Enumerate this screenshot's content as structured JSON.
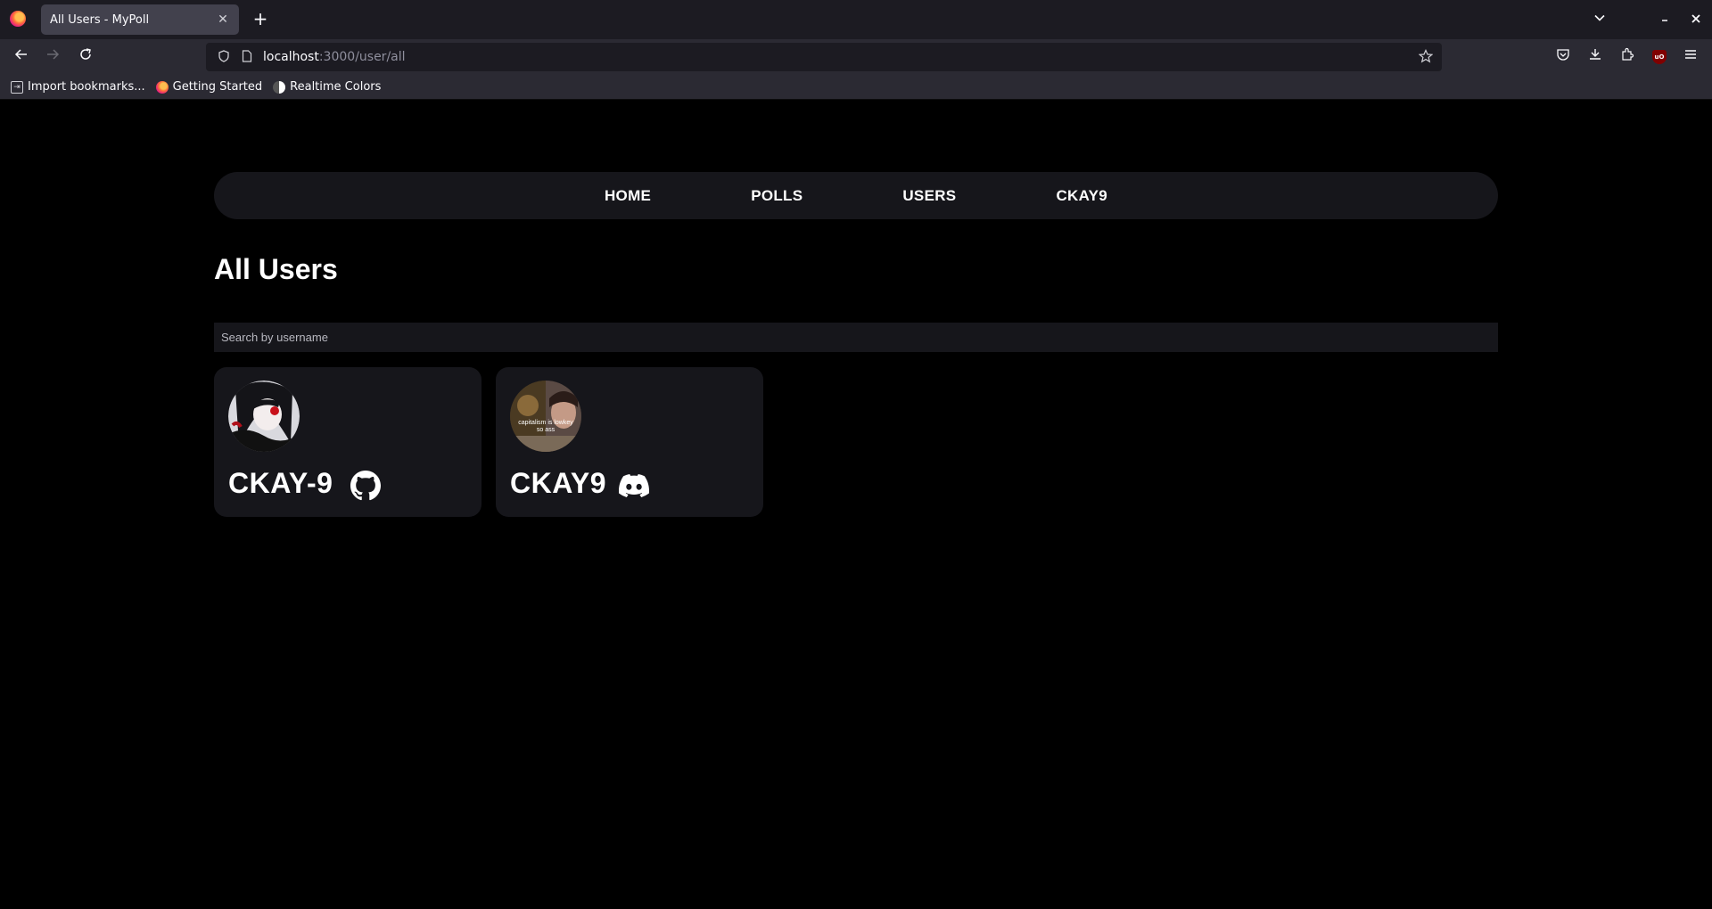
{
  "browser": {
    "tab_title": "All Users - MyPoll",
    "tab_close": "✕",
    "new_tab": "+",
    "url_host": "localhost",
    "url_path": ":3000/user/all",
    "bookmarks": [
      {
        "label": "Import bookmarks...",
        "icon": "import-icon"
      },
      {
        "label": "Getting Started",
        "icon": "firefox-icon"
      },
      {
        "label": "Realtime Colors",
        "icon": "realtime-colors-icon"
      }
    ]
  },
  "nav": {
    "links": [
      "HOME",
      "POLLS",
      "USERS",
      "CKAY9"
    ]
  },
  "page": {
    "title": "All Users",
    "search_placeholder": "Search by username"
  },
  "users": [
    {
      "name": "CKAY-9",
      "provider": "github",
      "provider_icon": "github-icon",
      "avatar_caption": ""
    },
    {
      "name": "CKAY9",
      "provider": "discord",
      "provider_icon": "discord-icon",
      "avatar_caption": "capitalism is lowkey so ass"
    }
  ],
  "colors": {
    "page_bg": "#000000",
    "surface": "#16161b",
    "text": "#ffffff"
  }
}
